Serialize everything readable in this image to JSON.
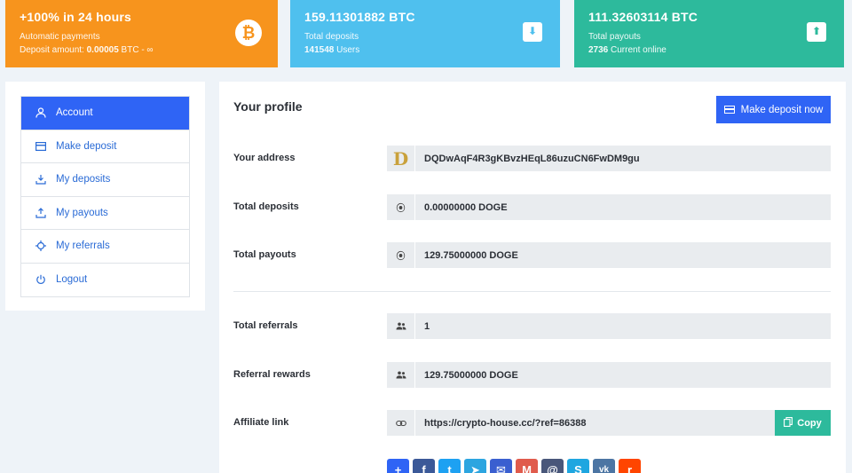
{
  "cards": [
    {
      "title": "+100% in 24 hours",
      "line1": "Automatic payments",
      "line2_prefix": "Deposit amount: ",
      "line2_bold": "0.00005",
      "line2_suffix": " BTC - ∞",
      "icon": "bitcoin-icon",
      "color": "#f7941d"
    },
    {
      "title": "159.11301882 BTC",
      "line1": "Total deposits",
      "line2_bold": "141548",
      "line2_suffix": " Users",
      "icon": "download-icon",
      "color": "#4fc0ee"
    },
    {
      "title": "111.32603114 BTC",
      "line1": "Total payouts",
      "line2_bold": "2736",
      "line2_suffix": " Current online",
      "icon": "upload-icon",
      "color": "#2dba9c"
    }
  ],
  "sidebar": {
    "items": [
      {
        "label": "Account",
        "icon": "user-icon",
        "active": true
      },
      {
        "label": "Make deposit",
        "icon": "credit-card-icon",
        "active": false
      },
      {
        "label": "My deposits",
        "icon": "download-tray-icon",
        "active": false
      },
      {
        "label": "My payouts",
        "icon": "upload-tray-icon",
        "active": false
      },
      {
        "label": "My referrals",
        "icon": "crosshair-icon",
        "active": false
      },
      {
        "label": "Logout",
        "icon": "power-icon",
        "active": false
      }
    ]
  },
  "profile": {
    "title": "Your profile",
    "deposit_button": "Make deposit now",
    "address_label": "Your address",
    "address_value": "DQDwAqF4R3gKBvzHEqL86uzuCN6FwDM9gu",
    "total_deposits_label": "Total deposits",
    "total_deposits_value": "0.00000000 DOGE",
    "total_payouts_label": "Total payouts",
    "total_payouts_value": "129.75000000 DOGE",
    "total_referrals_label": "Total referrals",
    "total_referrals_value": "1",
    "referral_rewards_label": "Referral rewards",
    "referral_rewards_value": "129.75000000 DOGE",
    "affiliate_label": "Affiliate link",
    "affiliate_value": "https://crypto-house.cc/?ref=86388",
    "copy_label": "Copy"
  },
  "share_buttons": [
    {
      "name": "addthis",
      "glyph": "+",
      "color": "#2f64f5"
    },
    {
      "name": "facebook",
      "glyph": "f",
      "color": "#3b5998"
    },
    {
      "name": "twitter",
      "glyph": "t",
      "color": "#1da1f2"
    },
    {
      "name": "telegram",
      "glyph": "➤",
      "color": "#2ca5e0"
    },
    {
      "name": "email",
      "glyph": "✉",
      "color": "#3a5fd0"
    },
    {
      "name": "gmail",
      "glyph": "M",
      "color": "#e05b4c"
    },
    {
      "name": "instapaper",
      "glyph": "@",
      "color": "#49577a"
    },
    {
      "name": "skype",
      "glyph": "S",
      "color": "#1ea6e0"
    },
    {
      "name": "vk",
      "glyph": "vk",
      "color": "#4c75a3"
    },
    {
      "name": "reddit",
      "glyph": "r",
      "color": "#ff4500"
    }
  ]
}
